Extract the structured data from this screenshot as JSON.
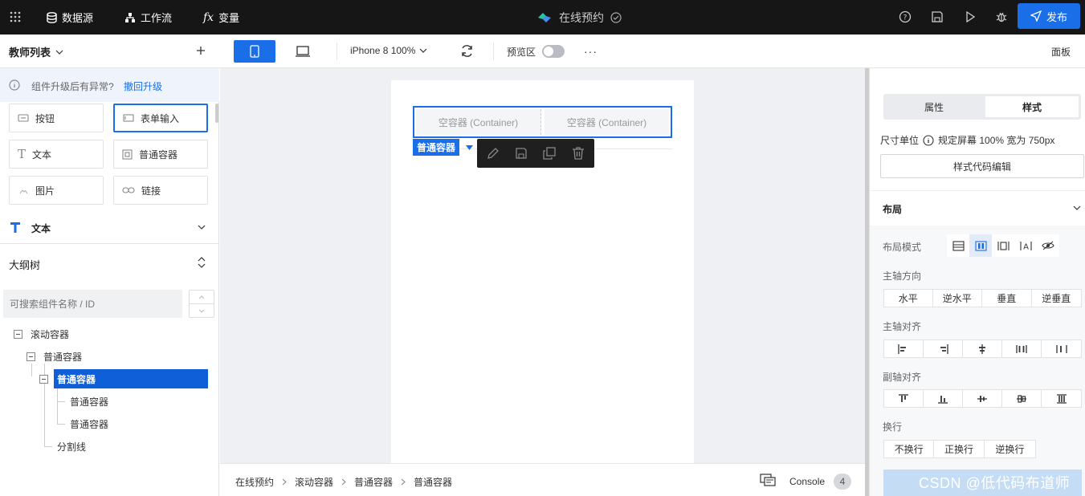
{
  "topbar": {
    "menu_icon": "grid-icon",
    "nav": [
      {
        "label": "数据源",
        "icon": "database-icon"
      },
      {
        "label": "工作流",
        "icon": "workflow-icon"
      },
      {
        "label": "变量",
        "icon": "fx-icon"
      }
    ],
    "app_title": "在线预约",
    "publish_label": "发布"
  },
  "toolbar": {
    "page_selector": "教师列表",
    "device_label": "iPhone 8 100%",
    "preview_label": "预览区",
    "panel_label": "面板"
  },
  "left": {
    "notice_text": "组件升级后有异常?",
    "notice_link": "撤回升级",
    "components": [
      {
        "label": "按钮",
        "icon": "button-icon"
      },
      {
        "label": "表单输入",
        "icon": "input-icon"
      },
      {
        "label": "文本",
        "icon": "text-icon"
      },
      {
        "label": "普通容器",
        "icon": "container-icon"
      },
      {
        "label": "图片",
        "icon": "image-icon"
      },
      {
        "label": "链接",
        "icon": "link-icon"
      }
    ],
    "section_text": "文本",
    "outline_title": "大纲树",
    "search_placeholder": "可搜索组件名称 / ID",
    "tree": [
      {
        "label": "滚动容器"
      },
      {
        "label": "普通容器"
      },
      {
        "label": "普通容器"
      },
      {
        "label": "普通容器"
      },
      {
        "label": "普通容器"
      },
      {
        "label": "分割线"
      }
    ]
  },
  "canvas": {
    "containers": [
      "空容器 (Container)",
      "空容器 (Container)"
    ],
    "selected_tag": "普通容器",
    "breadcrumb": [
      "在线预约",
      "滚动容器",
      "普通容器",
      "普通容器"
    ],
    "console_label": "Console",
    "console_count": "4"
  },
  "right": {
    "tabs": [
      "属性",
      "样式"
    ],
    "unit_label": "尺寸单位",
    "unit_value": "规定屏幕 100% 宽为 750px",
    "style_code_button": "样式代码编辑",
    "layout_title": "布局",
    "layout_mode_label": "布局模式",
    "main_axis_dir_label": "主轴方向",
    "main_axis_dir_options": [
      "水平",
      "逆水平",
      "垂直",
      "逆垂直"
    ],
    "main_axis_align_label": "主轴对齐",
    "cross_axis_align_label": "副轴对齐",
    "wrap_label": "换行",
    "wrap_options": [
      "不换行",
      "正换行",
      "逆换行"
    ]
  },
  "watermark": "CSDN @低代码布道师",
  "colors": {
    "accent": "#1a6ee8",
    "topbar": "#161616",
    "selected": "#0e5fd8"
  }
}
